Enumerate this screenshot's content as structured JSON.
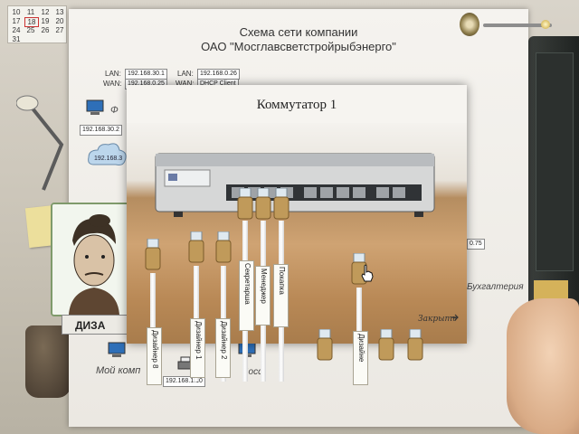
{
  "calendar": {
    "rows": [
      [
        "10",
        "11",
        "12",
        "13"
      ],
      [
        "17",
        "18",
        "19",
        "20"
      ],
      [
        "24",
        "25",
        "26",
        "27"
      ],
      [
        "31",
        "",
        "",
        " "
      ]
    ]
  },
  "diagram": {
    "title_line1": "Схема сети компании",
    "title_line2": "ОАО \"Мосглавсветстройрыбэнерго\"",
    "lan_label": "LAN:",
    "wan_label": "WAN:",
    "lan_ip1": "192.168.30.1",
    "lan_ip2": "192.168.0.26",
    "wan_ip1": "192.168.0.25",
    "wan_ip2": "DHCP Client",
    "left_ip1": "192.168.30.2",
    "left_ip2": "192.168.3",
    "bottom_ip": "192.168.1.10",
    "right_ip": "0.75",
    "right_label": "Бухгалтерия",
    "my_pc_label": "Мой комп",
    "bottom_label2": "Босс",
    "left_partial": "Ф"
  },
  "avatar": {
    "name_label": "ДИЗА"
  },
  "modal": {
    "title": "Коммутатор 1",
    "close_label": "Закрыть",
    "cables_top": [
      {
        "label": "Секретарша"
      },
      {
        "label": "Менеджер"
      },
      {
        "label": "Покапка"
      }
    ],
    "cables_left": [
      {
        "label": "Дизайнер 8"
      },
      {
        "label": "Дизайнер 1"
      },
      {
        "label": "Дизайнер 2"
      }
    ],
    "cable_active": {
      "label": "Дизайне"
    }
  },
  "colors": {
    "paper": "#f5f3ef",
    "avatar_border": "#7f9a6b",
    "plug_gold": "#c09a5a"
  }
}
